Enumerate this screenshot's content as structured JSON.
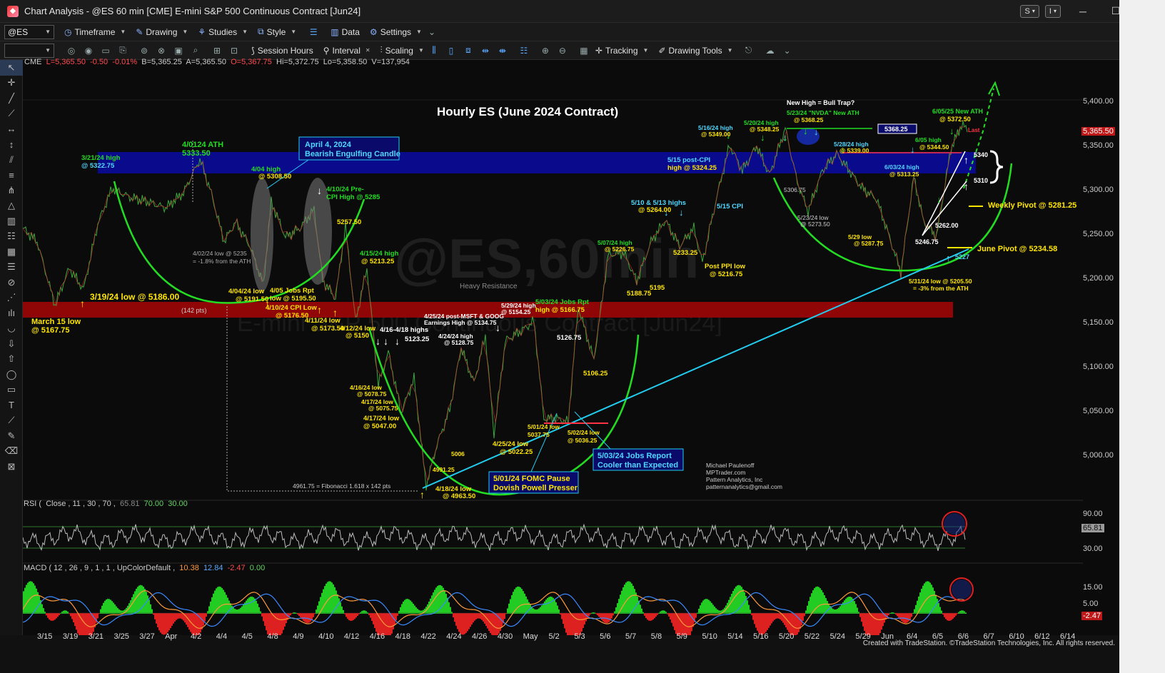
{
  "window": {
    "title": "Chart Analysis - @ES 60 min [CME] E-mini S&P 500 Continuous Contract [Jun24]",
    "btn_s": "S",
    "btn_i": "I"
  },
  "toolbar1": {
    "symbol": "@ES",
    "timeframe": "Timeframe",
    "drawing": "Drawing",
    "studies": "Studies",
    "style": "Style",
    "data": "Data",
    "settings": "Settings"
  },
  "toolbar2": {
    "session_hours": "Session Hours",
    "interval": "Interval",
    "scaling": "Scaling",
    "tracking": "Tracking",
    "drawing_tools": "Drawing Tools"
  },
  "symbol_line": {
    "exchange": "CME",
    "last": "L=5,365.50",
    "change": "-0.50",
    "pct": "-0.01%",
    "bid": "B=5,365.25",
    "ask": "A=5,365.50",
    "open": "O=5,367.75",
    "high": "Hi=5,372.75",
    "low": "Lo=5,358.50",
    "volume": "V=137,954"
  },
  "price_axis": {
    "labels": [
      "5,400.00",
      "5,350.00",
      "5,300.00",
      "5,250.00",
      "5,200.00",
      "5,150.00",
      "5,100.00",
      "5,050.00",
      "5,000.00"
    ],
    "last_price": "5,365.50"
  },
  "time_axis": [
    "3/15",
    "3/19",
    "3/21",
    "3/25",
    "3/27",
    "Apr",
    "4/2",
    "4/4",
    "4/5",
    "4/8",
    "4/9",
    "4/10",
    "4/12",
    "4/16",
    "4/18",
    "4/22",
    "4/24",
    "4/26",
    "4/30",
    "May",
    "5/2",
    "5/3",
    "5/6",
    "5/7",
    "5/8",
    "5/9",
    "5/10",
    "5/14",
    "5/16",
    "5/20",
    "5/22",
    "5/24",
    "5/29",
    "Jun",
    "6/4",
    "6/5",
    "6/6",
    "6/7",
    "6/10",
    "6/12",
    "6/14"
  ],
  "rsi": {
    "label": "RSI (",
    "params": "Close , 11 , 30 , 70 ,",
    "value": "65.81",
    "overbought": "70.00",
    "oversold": "30.00",
    "axis": [
      "90.00",
      "30.00"
    ],
    "last": "65.81"
  },
  "macd": {
    "label": "MACD ( 12 , 26 , 9 , 1 , 1 , UpColorDefault ,",
    "v1": "10.38",
    "v2": "12.84",
    "v3": "-2.47",
    "v4": "0.00",
    "axis": [
      "15.00",
      "5.00"
    ],
    "last": "-2.47"
  },
  "annotations": {
    "chart_title": "Hourly ES (June 2024 Contract)",
    "ath_0401": "4/0124 ATH",
    "ath_0401_val": "5333.50",
    "high_0321": "3/21/24 high",
    "high_0321_val": "@ 5322.75",
    "box_april4_l1": "April 4, 2024",
    "box_april4_l2": "Bearish Engulfing Candle",
    "high_0404": "4/04 high",
    "high_0404_val": "@ 5308.50",
    "pre_cpi_l1": "4/10/24 Pre-",
    "pre_cpi_l2": "CPI High @ 5285",
    "v5257": "5257.50",
    "low_0319": "3/19/24 low @ 5186.00",
    "pts142": "(142 pts)",
    "march15_l1": "March 15 low",
    "march15_l2": "@ 5167.75",
    "low_0402_l1": "4/02/24 low @ 5235",
    "low_0402_l2": "= -1.8% from the ATH",
    "low_0404": "4/04/24 low",
    "low_0404_val": "@ 5191.50",
    "jobs_0405_l1": "4/05 Jobs Rpt",
    "jobs_0405_l2": "low @ 5195.50",
    "cpi_0410_l1": "4/10/24 CPI Low",
    "cpi_0410_l2": "@ 5176.50",
    "low_0411": "4/11/24 low",
    "low_0411_val": "@ 5173.50",
    "low_0412": "4/12/24 low",
    "low_0412_val": "@ 5150",
    "high_0415": "4/15/24 high",
    "high_0415_val": "@ 5213.25",
    "highs_0416_0418": "4/16-4/18 highs",
    "v5123": "5123.25",
    "low_0416": "4/16/24 low",
    "low_0416_val": "@ 5078.75",
    "low_0417": "4/17/24 low",
    "low_0417_val": "@ 5075.75",
    "low_0417b": "4/17/24 low",
    "low_0417b_val": "@ 5047.00",
    "v4991": "4991.25",
    "v5006": "5006",
    "low_0418": "4/18/24 low",
    "low_0418_val": "@ 4963.50",
    "fib": "4961.75 = Fibonacci 1.618 x 142 pts",
    "msft_l1": "4/25/24 post-MSFT & GOOG",
    "msft_l2": "Earnings High @ 5134.75",
    "high_0424": "4/24/24 high",
    "high_0424_val": "@ 5128.75",
    "high_0429": "5/29/24 high",
    "high_0429_val": "@ 5154.25",
    "low_0425": "4/25/24 low",
    "low_0425_val": "@ 5022.25",
    "jobs_0503_l1": "5/03/24 Jobs Rpt",
    "jobs_0503_l2": "high @ 5166.75",
    "v5126": "5126.75",
    "v5106": "5106.25",
    "low_0501": "5/01/24 low",
    "low_0501_val": "5037.75",
    "low_0502": "5/02/24 low",
    "low_0502_val": "@ 5036.25",
    "fomc_l1": "5/01/24 FOMC Pause",
    "fomc_l2": "Dovish Powell Presser",
    "jobsbox_l1": "5/03/24 Jobs Report",
    "jobsbox_l2": "Cooler than Expected",
    "high_0507": "5/07/24 high",
    "high_0507_val": "@ 5226.75",
    "v5188": "5188.75",
    "v5195": "5195",
    "highs_0510": "5/10 & 5/13 highs",
    "highs_0510_val": "@ 5264.00",
    "v5233": "5233.25",
    "ppi_l1": "Post PPI low",
    "ppi_l2": "@ 5216.75",
    "cpi_0515": "5/15 CPI",
    "post_cpi_l1": "5/15 post-CPI",
    "post_cpi_l2": "high @ 5324.25",
    "high_0516": "5/16/24 high",
    "high_0516_val": "@ 5349.00",
    "high_0520": "5/20/24 high",
    "high_0520_val": "@ 5348.25",
    "bull_trap": "New High = Bull Trap?",
    "nvda_l1": "5/23/24 \"NVDA\" New ATH",
    "nvda_l2": "@ 5368.25",
    "v5368": "5368.25",
    "v5306": "5306.75",
    "low_0523": "5/23/24 low",
    "low_0523_val": "@ 5273.50",
    "high_0528": "5/28/24 high",
    "high_0528_val": "@ 5339.00",
    "high_0603": "6/03/24 high",
    "high_0603_val": "@ 5313.25",
    "low_0529": "5/29 low",
    "low_0529_val": "@ 5287.75",
    "high_0605": "6/05 high",
    "high_0605_val": "@ 5344.50",
    "ath_0605": "6/05/25 New ATH",
    "ath_0605_val": "@ 5372.50",
    "last_tag": "Last",
    "v5340": "5340",
    "v5310": "5310",
    "v5262": "5262.00",
    "v5246": "5246.75",
    "v5227": "5227",
    "weekly_pivot": "Weekly Pivot @ 5281.25",
    "june_pivot": "June Pivot @ 5234.58",
    "low_0531_l1": "5/31/24 low @ 5205.50",
    "low_0531_l2": "= -3% from the ATH",
    "author_1": "Michael Paulenoff",
    "author_2": "MPTrader.com",
    "author_3": "Pattern Analytics, Inc",
    "author_4": "patternanalytics@gmail.com",
    "watermark": "@ES,60min",
    "heavy_resistance": "Heavy Resistance",
    "watermark2": "E-mini S&P 500 Continuous Contract [Jun24]"
  },
  "colors": {
    "accent_blue": "#0000a8",
    "support_red": "#9a0000",
    "arc_green": "#22dd22",
    "trend_cyan": "#22ccee"
  },
  "credit": "Created with TradeStation. ©TradeStation Technologies, Inc. All rights reserved."
}
